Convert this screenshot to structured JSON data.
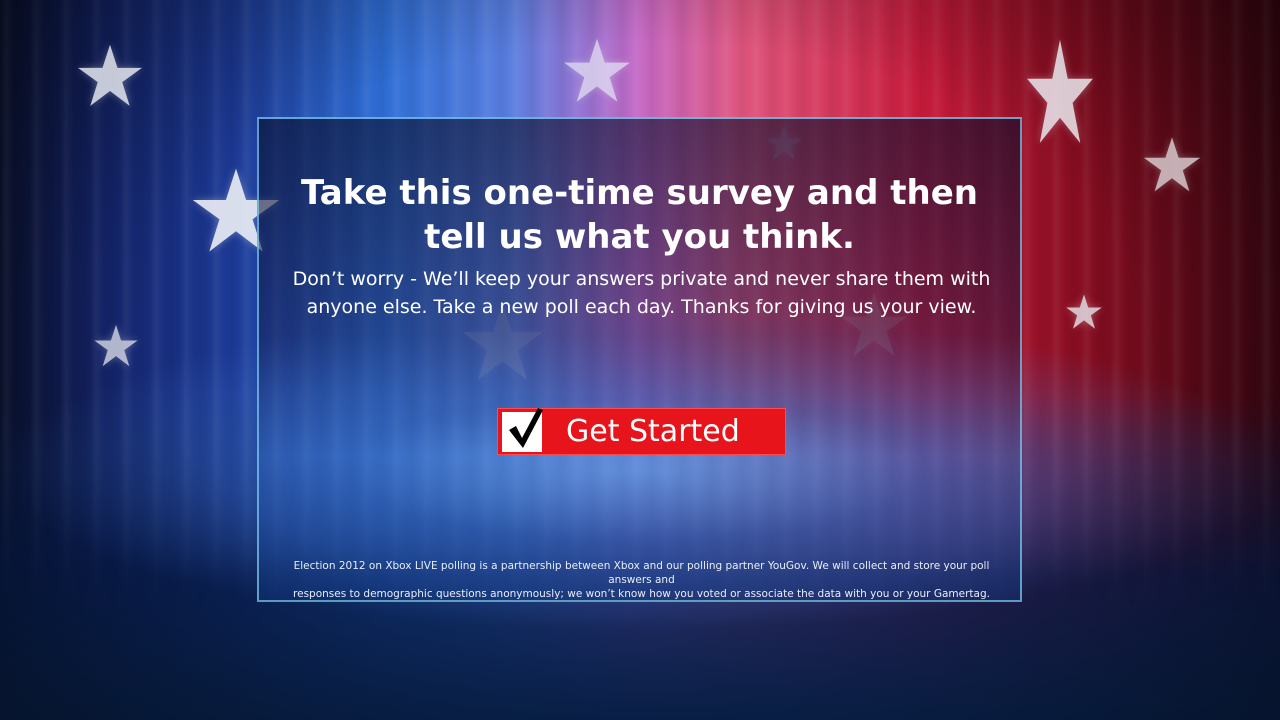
{
  "survey": {
    "title_line1": "Take this one-time survey and then",
    "title_line2": "tell us what you think.",
    "subtitle_line1": "Don’t worry - We’ll keep your answers private and never share them with",
    "subtitle_line2": "anyone else. Take a new poll each day. Thanks for giving us your view.",
    "get_started_label": "Get Started",
    "disclaimer_line1": "Election 2012 on Xbox LIVE polling is a partnership between Xbox and our polling partner YouGov.  We will collect and store your poll answers and",
    "disclaimer_line2": "responses to demographic questions anonymously; we won’t know how you voted or associate the data with you or your Gamertag."
  },
  "icons": {
    "checkmark": "checkmark-icon",
    "star": "star-icon"
  },
  "colors": {
    "button_red": "#e8141c",
    "panel_border": "#78c8eb",
    "text": "#ffffff"
  }
}
